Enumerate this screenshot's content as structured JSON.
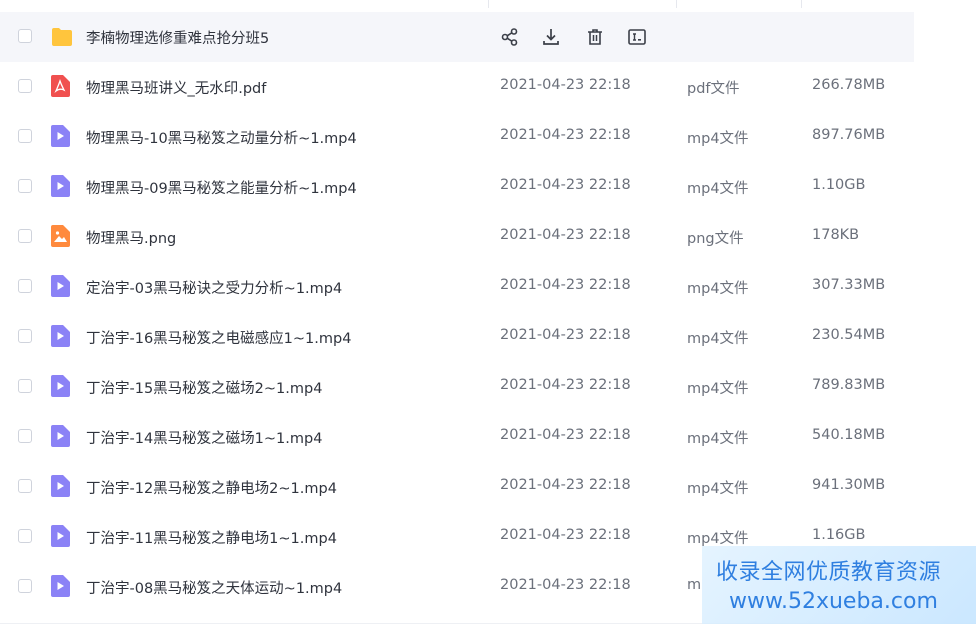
{
  "actions": {
    "share": "share-icon",
    "download": "download-icon",
    "delete": "trash-icon",
    "rename": "rename-icon"
  },
  "colors": {
    "folder": "#FFC53D",
    "pdf": "#F0504F",
    "video": "#8B82F6",
    "image": "#FF8A3D",
    "watermark_text": "#2F7FE0"
  },
  "files": [
    {
      "name": "李楠物理选修重难点抢分班5",
      "icon": "folder-icon",
      "date": "",
      "type": "",
      "size": ""
    },
    {
      "name": "物理黑马班讲义_无水印.pdf",
      "icon": "pdf-icon",
      "date": "2021-04-23 22:18",
      "type": "pdf文件",
      "size": "266.78MB"
    },
    {
      "name": "物理黑马-10黑马秘笈之动量分析~1.mp4",
      "icon": "video-icon",
      "date": "2021-04-23 22:18",
      "type": "mp4文件",
      "size": "897.76MB"
    },
    {
      "name": "物理黑马-09黑马秘笈之能量分析~1.mp4",
      "icon": "video-icon",
      "date": "2021-04-23 22:18",
      "type": "mp4文件",
      "size": "1.10GB"
    },
    {
      "name": "物理黑马.png",
      "icon": "image-icon",
      "date": "2021-04-23 22:18",
      "type": "png文件",
      "size": "178KB"
    },
    {
      "name": "定治宇-03黑马秘诀之受力分析~1.mp4",
      "icon": "video-icon",
      "date": "2021-04-23 22:18",
      "type": "mp4文件",
      "size": "307.33MB"
    },
    {
      "name": "丁治宇-16黑马秘笈之电磁感应1~1.mp4",
      "icon": "video-icon",
      "date": "2021-04-23 22:18",
      "type": "mp4文件",
      "size": "230.54MB"
    },
    {
      "name": "丁治宇-15黑马秘笈之磁场2~1.mp4",
      "icon": "video-icon",
      "date": "2021-04-23 22:18",
      "type": "mp4文件",
      "size": "789.83MB"
    },
    {
      "name": "丁治宇-14黑马秘笈之磁场1~1.mp4",
      "icon": "video-icon",
      "date": "2021-04-23 22:18",
      "type": "mp4文件",
      "size": "540.18MB"
    },
    {
      "name": "丁治宇-12黑马秘笈之静电场2~1.mp4",
      "icon": "video-icon",
      "date": "2021-04-23 22:18",
      "type": "mp4文件",
      "size": "941.30MB"
    },
    {
      "name": "丁治宇-11黑马秘笈之静电场1~1.mp4",
      "icon": "video-icon",
      "date": "2021-04-23 22:18",
      "type": "mp4文件",
      "size": "1.16GB"
    },
    {
      "name": "丁治宇-08黑马秘笈之天体运动~1.mp4",
      "icon": "video-icon",
      "date": "2021-04-23 22:18",
      "type": "m",
      "size": ""
    }
  ],
  "watermark": {
    "line1": "收录全网优质教育资源",
    "line2": "www.52xueba.com"
  }
}
